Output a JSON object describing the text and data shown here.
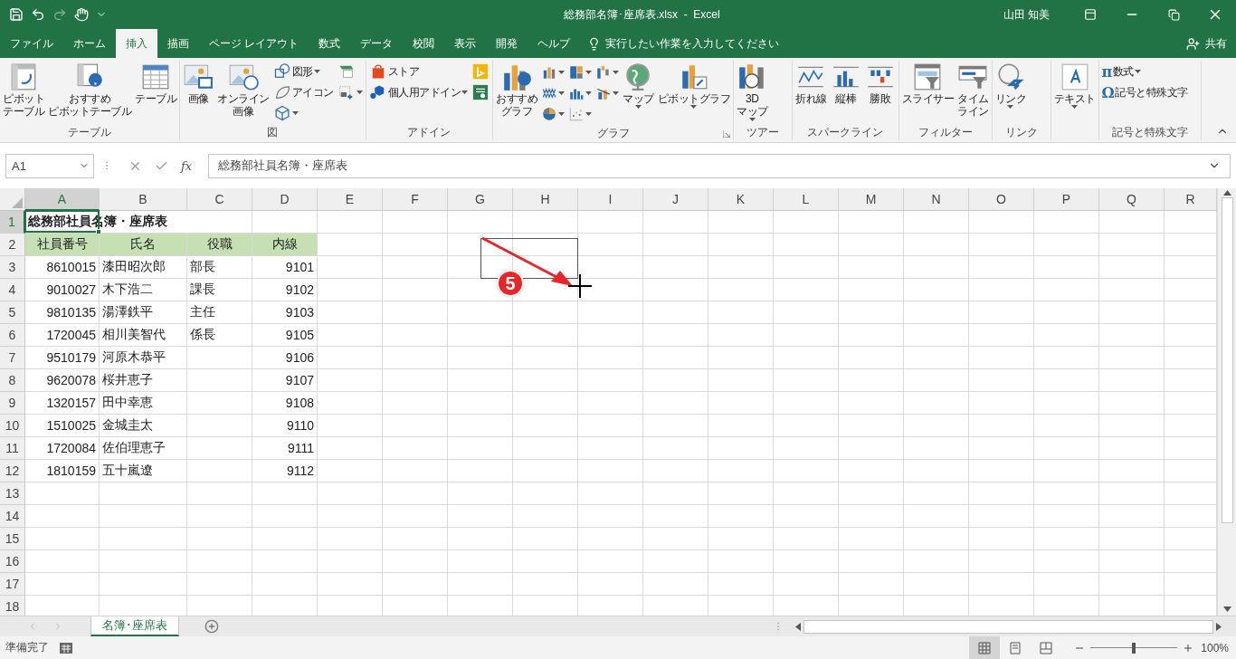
{
  "title_bar": {
    "title": "総務部名簿･座席表.xlsx  -  Excel",
    "user": "山田 知美"
  },
  "menu_tabs": [
    {
      "label": "ファイル",
      "selected": false
    },
    {
      "label": "ホーム",
      "selected": false
    },
    {
      "label": "挿入",
      "selected": true
    },
    {
      "label": "描画",
      "selected": false
    },
    {
      "label": "ページ レイアウト",
      "selected": false
    },
    {
      "label": "数式",
      "selected": false
    },
    {
      "label": "データ",
      "selected": false
    },
    {
      "label": "校閲",
      "selected": false
    },
    {
      "label": "表示",
      "selected": false
    },
    {
      "label": "開発",
      "selected": false
    },
    {
      "label": "ヘルプ",
      "selected": false
    }
  ],
  "tell_me": {
    "placeholder": "実行したい作業を入力してください"
  },
  "share": "共有",
  "ribbon": [
    {
      "label": "テーブル",
      "items": [
        {
          "kind": "large",
          "lines": [
            "ピボット",
            "テーブル"
          ],
          "dropdown": false
        },
        {
          "kind": "large",
          "lines": [
            "おすすめ",
            "ピボットテーブル"
          ],
          "dropdown": false
        },
        {
          "kind": "large",
          "lines": [
            "テーブル"
          ],
          "dropdown": false
        }
      ]
    },
    {
      "label": "図",
      "items": [
        {
          "kind": "large",
          "lines": [
            "画像"
          ],
          "dropdown": false
        },
        {
          "kind": "large",
          "lines": [
            "オンライン",
            "画像"
          ],
          "dropdown": false
        },
        {
          "kind": "stack",
          "rows": [
            {
              "label": "図形",
              "dropdown": true
            },
            {
              "label": "アイコン",
              "dropdown": false
            },
            {
              "dropdown": true
            }
          ]
        },
        {
          "kind": "stack",
          "rows": [
            {
              "dropdown": false
            },
            {
              "dropdown": true
            }
          ]
        }
      ]
    },
    {
      "label": "アドイン",
      "items": [
        {
          "kind": "stack",
          "rows": [
            {
              "label": "ストア",
              "dropdown": false
            },
            {
              "label": "個人用アドイン",
              "dropdown": true
            }
          ]
        },
        {
          "kind": "stack",
          "rows": [
            {
              "dropdown": false
            },
            {
              "dropdown": false
            }
          ]
        }
      ]
    },
    {
      "label": "グラフ",
      "launcher": true,
      "items": [
        {
          "kind": "large",
          "lines": [
            "おすすめ",
            "グラフ"
          ],
          "dropdown": false
        },
        {
          "kind": "icongrid",
          "cells": [
            {
              "dropdown": true
            },
            {
              "dropdown": true
            },
            {
              "dropdown": true
            },
            {
              "dropdown": true
            },
            {
              "dropdown": true
            },
            {
              "dropdown": true
            },
            {
              "dropdown": true
            },
            {
              "dropdown": true
            }
          ]
        },
        {
          "kind": "large",
          "lines": [
            "マップ"
          ],
          "dropdown": true
        },
        {
          "kind": "large",
          "lines": [
            "ピボットグラフ"
          ],
          "dropdown": true
        }
      ]
    },
    {
      "label": "ツアー",
      "items": [
        {
          "kind": "large",
          "lines": [
            "3D",
            "マップ"
          ],
          "dropdown": true
        }
      ]
    },
    {
      "label": "スパークライン",
      "items": [
        {
          "kind": "large",
          "lines": [
            "折れ線"
          ],
          "dropdown": false
        },
        {
          "kind": "large",
          "lines": [
            "縦棒"
          ],
          "dropdown": false
        },
        {
          "kind": "large",
          "lines": [
            "勝敗"
          ],
          "dropdown": false
        }
      ]
    },
    {
      "label": "フィルター",
      "items": [
        {
          "kind": "large",
          "lines": [
            "スライサー"
          ],
          "dropdown": false
        },
        {
          "kind": "large",
          "lines": [
            "タイム",
            "ライン"
          ],
          "dropdown": false
        }
      ]
    },
    {
      "label": "リンク",
      "items": [
        {
          "kind": "large",
          "lines": [
            "リンク"
          ],
          "dropdown": true
        }
      ]
    },
    {
      "items": [
        {
          "kind": "large",
          "lines": [
            "テキスト"
          ],
          "dropdown": true
        }
      ]
    },
    {
      "label": "記号と特殊文字",
      "items": [
        {
          "kind": "stack",
          "rows": [
            {
              "glyph": "π",
              "label": "数式",
              "dropdown": true
            },
            {
              "glyph": "Ω",
              "label": "記号と特殊文字",
              "dropdown": false
            }
          ]
        }
      ]
    }
  ],
  "formula_bar": {
    "name_box": "A1",
    "fx": "fx",
    "value": "総務部社員名簿・座席表"
  },
  "sheet": {
    "columns": [
      {
        "label": "A",
        "selected": true
      },
      {
        "label": "B",
        "selected": false
      },
      {
        "label": "C",
        "selected": false
      },
      {
        "label": "D",
        "selected": false
      },
      {
        "label": "E",
        "selected": false
      },
      {
        "label": "F",
        "selected": false
      },
      {
        "label": "G",
        "selected": false
      },
      {
        "label": "H",
        "selected": false
      },
      {
        "label": "I",
        "selected": false
      },
      {
        "label": "J",
        "selected": false
      },
      {
        "label": "K",
        "selected": false
      },
      {
        "label": "L",
        "selected": false
      },
      {
        "label": "M",
        "selected": false
      },
      {
        "label": "N",
        "selected": false
      },
      {
        "label": "O",
        "selected": false
      },
      {
        "label": "P",
        "selected": false
      },
      {
        "label": "Q",
        "selected": false
      },
      {
        "label": "R",
        "selected": false
      }
    ],
    "rows": [
      {
        "label": "1",
        "selected": true,
        "kind": "title",
        "cells": [
          "総務部社員名簿・座席表"
        ]
      },
      {
        "label": "2",
        "selected": false,
        "kind": "header",
        "cells": [
          "社員番号",
          "氏名",
          "役職",
          "内線"
        ]
      },
      {
        "label": "3",
        "selected": false,
        "kind": "data",
        "cells": [
          "8610015",
          "漆田昭次郎",
          "部長",
          "9101"
        ]
      },
      {
        "label": "4",
        "selected": false,
        "kind": "data",
        "cells": [
          "9010027",
          "木下浩二",
          "課長",
          "9102"
        ]
      },
      {
        "label": "5",
        "selected": false,
        "kind": "data",
        "cells": [
          "9810135",
          "湯澤鉄平",
          "主任",
          "9103"
        ]
      },
      {
        "label": "6",
        "selected": false,
        "kind": "data",
        "cells": [
          "1720045",
          "相川美智代",
          "係長",
          "9105"
        ]
      },
      {
        "label": "7",
        "selected": false,
        "kind": "data",
        "cells": [
          "9510179",
          "河原木恭平",
          "",
          "9106"
        ]
      },
      {
        "label": "8",
        "selected": false,
        "kind": "data",
        "cells": [
          "9620078",
          "桜井恵子",
          "",
          "9107"
        ]
      },
      {
        "label": "9",
        "selected": false,
        "kind": "data",
        "cells": [
          "1320157",
          "田中幸恵",
          "",
          "9108"
        ]
      },
      {
        "label": "10",
        "selected": false,
        "kind": "data",
        "cells": [
          "1510025",
          "金城圭太",
          "",
          "9110"
        ]
      },
      {
        "label": "11",
        "selected": false,
        "kind": "data",
        "cells": [
          "1720084",
          "佐伯理恵子",
          "",
          "9111"
        ]
      },
      {
        "label": "12",
        "selected": false,
        "kind": "data",
        "cells": [
          "1810159",
          "五十嵐遼",
          "",
          "9112"
        ]
      },
      {
        "label": "13",
        "selected": false,
        "kind": "data"
      },
      {
        "label": "14",
        "selected": false,
        "kind": "data"
      },
      {
        "label": "15",
        "selected": false,
        "kind": "data"
      },
      {
        "label": "16",
        "selected": false,
        "kind": "data"
      },
      {
        "label": "17",
        "selected": false,
        "kind": "data"
      },
      {
        "label": "18",
        "selected": false,
        "kind": "data"
      }
    ]
  },
  "annotation": {
    "step": "5"
  },
  "sheet_tabs": [
    {
      "label": "名簿･座席表",
      "selected": true
    }
  ],
  "status_bar": {
    "text": "準備完了",
    "views": [
      {
        "selected": true
      },
      {
        "selected": false
      },
      {
        "selected": false
      }
    ],
    "zoom": {
      "level": 0.5,
      "reading": "100%"
    }
  }
}
